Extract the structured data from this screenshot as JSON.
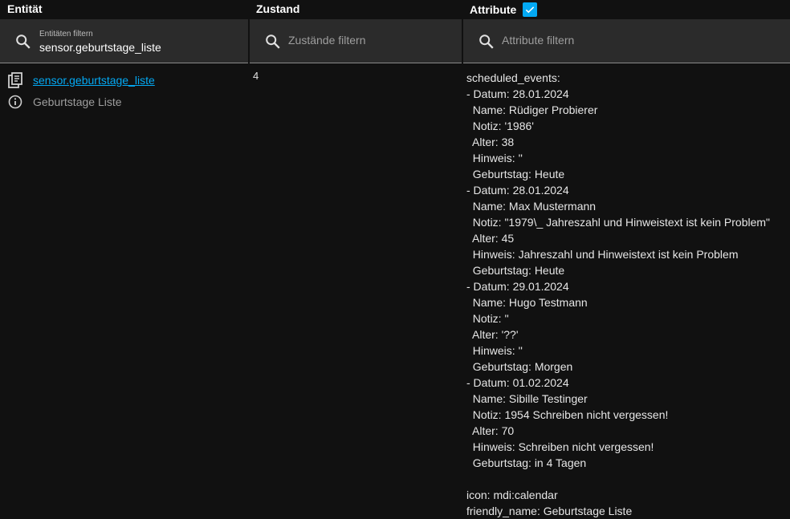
{
  "headers": {
    "entity": "Entität",
    "state": "Zustand",
    "attributes": "Attribute",
    "attributes_checked": true
  },
  "filters": {
    "entity_label": "Entitäten filtern",
    "entity_value": "sensor.geburtstage_liste",
    "state_placeholder": "Zustände filtern",
    "attributes_placeholder": "Attribute filtern"
  },
  "row": {
    "entity_id": "sensor.geburtstage_liste",
    "friendly_name": "Geburtstage Liste",
    "state": "4",
    "attributes_lines": [
      "scheduled_events:",
      "- Datum: 28.01.2024",
      "  Name: Rüdiger Probierer",
      "  Notiz: '1986'",
      "  Alter: 38",
      "  Hinweis: ''",
      "  Geburtstag: Heute",
      "- Datum: 28.01.2024",
      "  Name: Max Mustermann",
      "  Notiz: \"1979\\_ Jahreszahl und Hinweistext ist kein Problem\"",
      "  Alter: 45",
      "  Hinweis: Jahreszahl und Hinweistext ist kein Problem",
      "  Geburtstag: Heute",
      "- Datum: 29.01.2024",
      "  Name: Hugo Testmann",
      "  Notiz: ''",
      "  Alter: '??'",
      "  Hinweis: ''",
      "  Geburtstag: Morgen",
      "- Datum: 01.02.2024",
      "  Name: Sibille Testinger",
      "  Notiz: 1954 Schreiben nicht vergessen!",
      "  Alter: 70",
      "  Hinweis: Schreiben nicht vergessen!",
      "  Geburtstag: in 4 Tagen",
      "",
      "icon: mdi:calendar",
      "friendly_name: Geburtstage Liste"
    ]
  },
  "colors": {
    "accent": "#03a9f4",
    "background": "#111111",
    "field": "#2b2b2b"
  }
}
